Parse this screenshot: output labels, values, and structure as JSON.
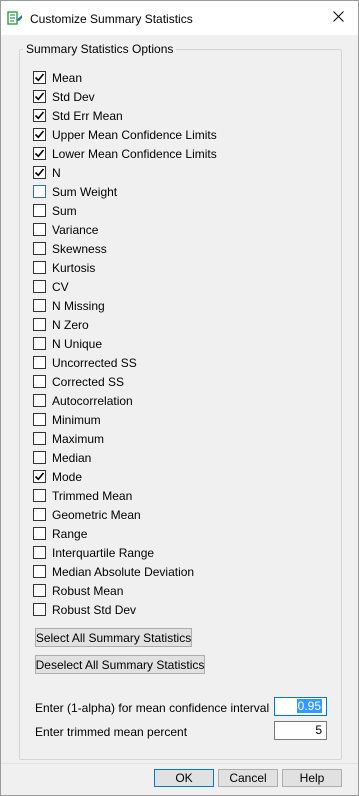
{
  "window": {
    "title": "Customize Summary Statistics",
    "close_glyph": "✕"
  },
  "group": {
    "legend": "Summary Statistics Options"
  },
  "stats": [
    {
      "label": "Mean",
      "checked": true
    },
    {
      "label": "Std Dev",
      "checked": true
    },
    {
      "label": "Std Err Mean",
      "checked": true
    },
    {
      "label": "Upper Mean Confidence Limits",
      "checked": true
    },
    {
      "label": "Lower Mean Confidence Limits",
      "checked": true
    },
    {
      "label": "N",
      "checked": true
    },
    {
      "label": "Sum Weight",
      "checked": false,
      "focus": true
    },
    {
      "label": "Sum",
      "checked": false
    },
    {
      "label": "Variance",
      "checked": false
    },
    {
      "label": "Skewness",
      "checked": false
    },
    {
      "label": "Kurtosis",
      "checked": false
    },
    {
      "label": "CV",
      "checked": false
    },
    {
      "label": "N Missing",
      "checked": false
    },
    {
      "label": "N Zero",
      "checked": false
    },
    {
      "label": "N Unique",
      "checked": false
    },
    {
      "label": "Uncorrected SS",
      "checked": false
    },
    {
      "label": "Corrected SS",
      "checked": false
    },
    {
      "label": "Autocorrelation",
      "checked": false
    },
    {
      "label": "Minimum",
      "checked": false
    },
    {
      "label": "Maximum",
      "checked": false
    },
    {
      "label": "Median",
      "checked": false
    },
    {
      "label": "Mode",
      "checked": true
    },
    {
      "label": "Trimmed Mean",
      "checked": false
    },
    {
      "label": "Geometric Mean",
      "checked": false
    },
    {
      "label": "Range",
      "checked": false
    },
    {
      "label": "Interquartile Range",
      "checked": false
    },
    {
      "label": "Median Absolute Deviation",
      "checked": false
    },
    {
      "label": "Robust Mean",
      "checked": false
    },
    {
      "label": "Robust Std Dev",
      "checked": false
    }
  ],
  "buttons": {
    "select_all": "Select All Summary Statistics",
    "deselect_all": "Deselect All Summary Statistics",
    "ok": "OK",
    "cancel": "Cancel",
    "help": "Help"
  },
  "fields": {
    "alpha_label": "Enter (1-alpha) for mean confidence interval",
    "alpha_value": "0.95",
    "trimmed_label": "Enter trimmed mean percent",
    "trimmed_value": "5"
  },
  "colors": {
    "accent": "#0078d7",
    "selection": "#3399ff",
    "icon_green": "#2e9e4a"
  }
}
